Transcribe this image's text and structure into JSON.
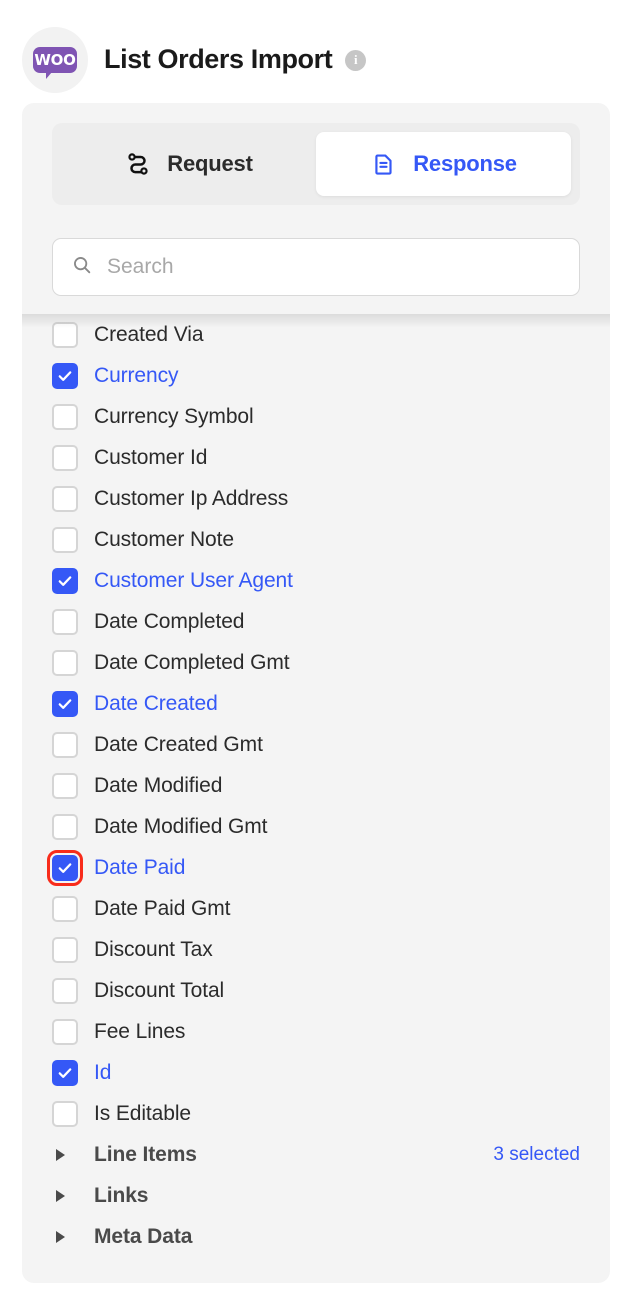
{
  "header": {
    "logo_text": "WOO",
    "logo_icon": "woocommerce-logo",
    "title": "List Orders Import",
    "info_icon": "info-icon",
    "info_glyph": "i"
  },
  "colors": {
    "accent_blue": "#3558f6",
    "woo_purple": "#7f54b3",
    "highlight_red": "#f82c1b",
    "panel_bg": "#f4f4f4",
    "tabbar_bg": "#ededed"
  },
  "tabs": [
    {
      "label": "Request",
      "icon": "route-icon",
      "active": false
    },
    {
      "label": "Response",
      "icon": "document-icon",
      "active": true
    }
  ],
  "search": {
    "icon": "search-icon",
    "placeholder": "Search",
    "value": ""
  },
  "fields": [
    {
      "label": "Created Via",
      "checked": false,
      "highlighted": false
    },
    {
      "label": "Currency",
      "checked": true,
      "highlighted": false
    },
    {
      "label": "Currency Symbol",
      "checked": false,
      "highlighted": false
    },
    {
      "label": "Customer Id",
      "checked": false,
      "highlighted": false
    },
    {
      "label": "Customer Ip Address",
      "checked": false,
      "highlighted": false
    },
    {
      "label": "Customer Note",
      "checked": false,
      "highlighted": false
    },
    {
      "label": "Customer User Agent",
      "checked": true,
      "highlighted": false
    },
    {
      "label": "Date Completed",
      "checked": false,
      "highlighted": false
    },
    {
      "label": "Date Completed Gmt",
      "checked": false,
      "highlighted": false
    },
    {
      "label": "Date Created",
      "checked": true,
      "highlighted": false
    },
    {
      "label": "Date Created Gmt",
      "checked": false,
      "highlighted": false
    },
    {
      "label": "Date Modified",
      "checked": false,
      "highlighted": false
    },
    {
      "label": "Date Modified Gmt",
      "checked": false,
      "highlighted": false
    },
    {
      "label": "Date Paid",
      "checked": true,
      "highlighted": true
    },
    {
      "label": "Date Paid Gmt",
      "checked": false,
      "highlighted": false
    },
    {
      "label": "Discount Tax",
      "checked": false,
      "highlighted": false
    },
    {
      "label": "Discount Total",
      "checked": false,
      "highlighted": false
    },
    {
      "label": "Fee Lines",
      "checked": false,
      "highlighted": false
    },
    {
      "label": "Id",
      "checked": true,
      "highlighted": false
    },
    {
      "label": "Is Editable",
      "checked": false,
      "highlighted": false
    }
  ],
  "groups": [
    {
      "label": "Line Items",
      "count": "3 selected",
      "icon": "chevron-right-icon"
    },
    {
      "label": "Links",
      "count": "",
      "icon": "chevron-right-icon"
    },
    {
      "label": "Meta Data",
      "count": "",
      "icon": "chevron-right-icon"
    }
  ]
}
